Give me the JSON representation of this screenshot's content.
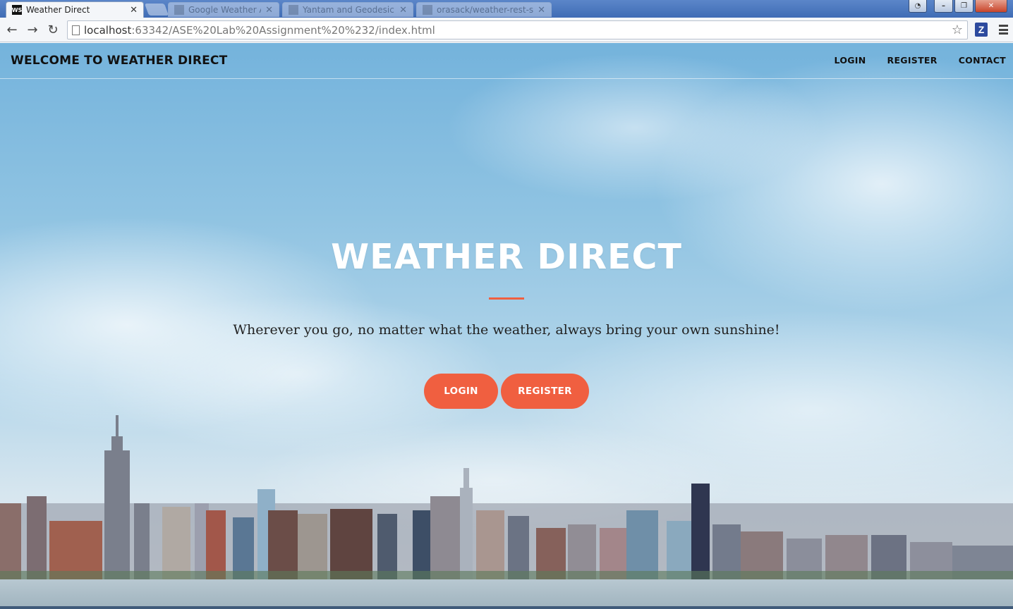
{
  "browser": {
    "tabs": [
      {
        "title": "Weather Direct",
        "favicon": "WS",
        "active": true
      },
      {
        "title": "Google Weather API Scr...",
        "active": false
      },
      {
        "title": "Yantam and Geodesic ...",
        "active": false
      },
      {
        "title": "orasack/weather-rest-s...",
        "active": false
      }
    ],
    "address": {
      "host": "localhost",
      "path": ":63342/ASE%20Lab%20Assignment%20%232/index.html"
    },
    "extension_letter": "Z"
  },
  "site": {
    "brand": "WELCOME TO WEATHER DIRECT",
    "nav": {
      "login": "LOGIN",
      "register": "REGISTER",
      "contact": "CONTACT"
    },
    "hero": {
      "title": "WEATHER DIRECT",
      "tagline": "Wherever you go, no matter what the weather, always bring your own sunshine!",
      "buttons": {
        "login": "LOGIN",
        "register": "REGISTER"
      }
    }
  },
  "colors": {
    "accent": "#f05f40",
    "sky_top": "#74b3dc",
    "brand_text": "#111111"
  },
  "icons": [
    "back-arrow-icon",
    "forward-arrow-icon",
    "reload-icon",
    "page-icon",
    "star-icon",
    "menu-icon",
    "close-icon",
    "minimize-icon",
    "maximize-icon",
    "user-icon"
  ]
}
